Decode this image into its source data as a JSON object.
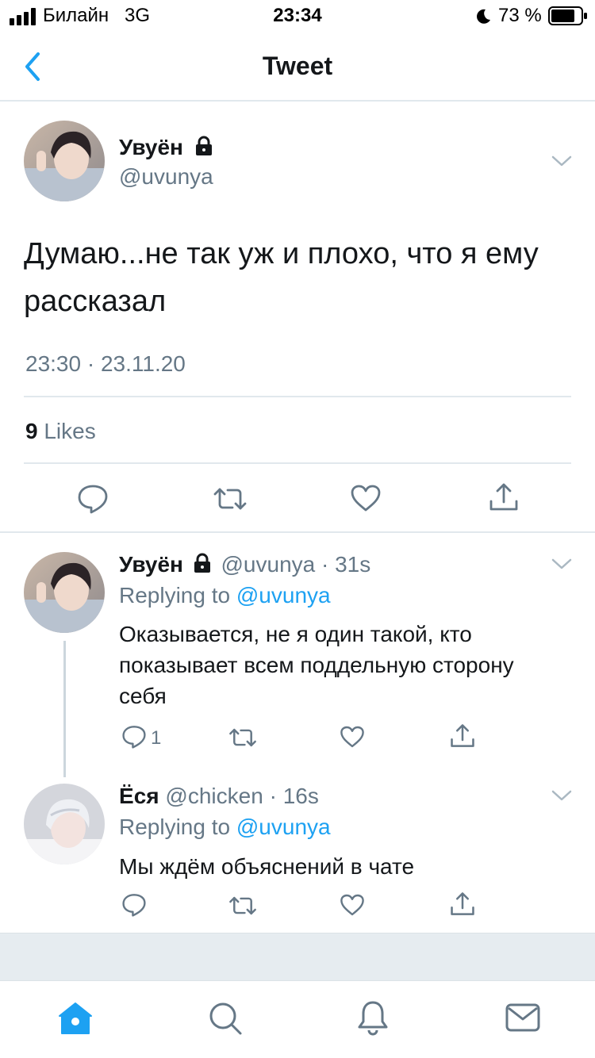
{
  "status_bar": {
    "carrier": "Билайн",
    "network": "3G",
    "time": "23:34",
    "battery": "73 %"
  },
  "nav": {
    "title": "Tweet"
  },
  "main_tweet": {
    "author_name": "Увуён",
    "handle": "@uvunya",
    "text_line1": "Думаю...не так уж и плохо, что я ему",
    "text_line2": "рассказал",
    "timestamp": "23:30 · 23.11.20",
    "likes_count": "9",
    "likes_label": "Likes"
  },
  "replies": [
    {
      "author_name": "Увуён",
      "handle": "@uvunya",
      "time": "31s",
      "replying_prefix": "Replying to",
      "replying_handle": "@uvunya",
      "text_line1": "Оказывается, не я один такой, кто",
      "text_line2": "показывает всем поддельную сторону",
      "text_line3": "себя",
      "reply_count": "1"
    },
    {
      "author_name": "Ёся",
      "handle": "@chicken",
      "time": "16s",
      "replying_prefix": "Replying to",
      "replying_handle": "@uvunya",
      "text_line1": "Мы ждём объяснений в чате",
      "reply_count": ""
    }
  ],
  "colors": {
    "accent": "#1da1f2",
    "icon_grey": "#657786",
    "divider": "#e1e8ed"
  },
  "icons": [
    "signal-icon",
    "moon-icon",
    "battery-icon",
    "back-chevron-icon",
    "lock-icon",
    "chevron-down-icon",
    "reply-icon",
    "retweet-icon",
    "like-icon",
    "share-icon",
    "home-icon",
    "search-icon",
    "notifications-icon",
    "messages-icon"
  ]
}
